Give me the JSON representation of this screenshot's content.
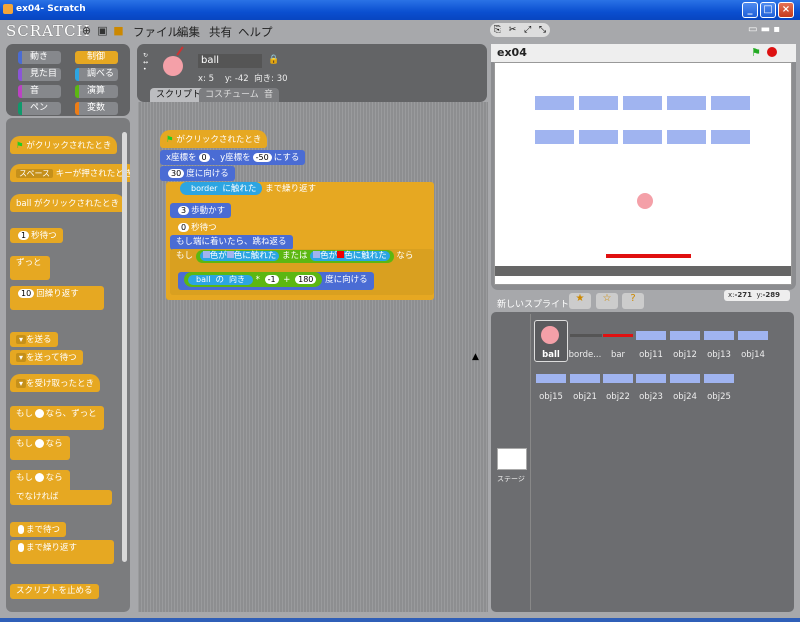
{
  "window": {
    "title": "ex04- Scratch",
    "min": "_",
    "max": "□",
    "close": "×"
  },
  "logo": "SCRATCH",
  "menu": [
    "ファイル",
    "編集",
    "共有",
    "ヘルプ"
  ],
  "categories": [
    {
      "label": "動き",
      "color": "#4a6cd4"
    },
    {
      "label": "制御",
      "color": "#e6a822"
    },
    {
      "label": "見た目",
      "color": "#8a55d7"
    },
    {
      "label": "調べる",
      "color": "#2ca5e2"
    },
    {
      "label": "音",
      "color": "#bb42c3"
    },
    {
      "label": "演算",
      "color": "#5cb712"
    },
    {
      "label": "ペン",
      "color": "#0e9a6c"
    },
    {
      "label": "変数",
      "color": "#ee7d16"
    }
  ],
  "palette": {
    "when_flag": "がクリックされたとき",
    "when_key_key": "スペース",
    "when_key": "キーが押されたとき",
    "when_clicked": "ball がクリックされたとき",
    "wait_val": "1",
    "wait": "秒待つ",
    "forever": "ずっと",
    "repeat_val": "10",
    "repeat": "回繰り返す",
    "broadcast": "を送る",
    "broadcast_wait": "を送って待つ",
    "when_receive": "を受け取ったとき",
    "forever_if_a": "もし",
    "forever_if_b": "なら、ずっと",
    "if_a": "もし",
    "if_b": "なら",
    "ifelse_a": "もし",
    "ifelse_b": "なら",
    "else": "でなければ",
    "wait_until": "まで待つ",
    "repeat_until": "まで繰り返す",
    "stop_script": "スクリプトを止める"
  },
  "sprite": {
    "name": "ball",
    "x_label": "x:",
    "x": "5",
    "y_label": "y:",
    "y": "-42",
    "dir_label": "向き:",
    "dir": "30"
  },
  "tabs": [
    "スクリプト",
    "コスチューム",
    "音"
  ],
  "script": {
    "hat": "がクリックされたとき",
    "goto_a": "x座標を",
    "goto_x": "0",
    "goto_b": "、y座標を",
    "goto_y": "-50",
    "goto_c": "にする",
    "point_val": "30",
    "point": "度に向ける",
    "until_field": "border",
    "until_a": "に触れた",
    "until_b": "まで繰り返す",
    "move_val": "3",
    "move": "歩動かす",
    "wait_val": "0",
    "wait": "秒待つ",
    "bounce": "もし端に着いたら、跳ね返る",
    "if": "もし",
    "c1": "色が",
    "c2": "色に触れた",
    "or": "または",
    "c3": "色が",
    "c4": "色に触れた",
    "then": "なら",
    "of_a": "ball",
    "of_b": "の",
    "of_c": "向き",
    "times": "*",
    "neg": "-1",
    "plus": "+",
    "add": "180",
    "point2": "度に向ける"
  },
  "stage": {
    "title": "ex04",
    "mouse_x_label": "x:",
    "mouse_x": "-271",
    "mouse_y_label": "y:",
    "mouse_y": "-289"
  },
  "new_sprite_label": "新しいスプライト:",
  "sprites": [
    "ball",
    "borde...",
    "bar",
    "obj11",
    "obj12",
    "obj13",
    "obj14",
    "obj15",
    "obj21",
    "obj22",
    "obj23",
    "obj24",
    "obj25"
  ],
  "stage_thumb_label": "ステージ"
}
